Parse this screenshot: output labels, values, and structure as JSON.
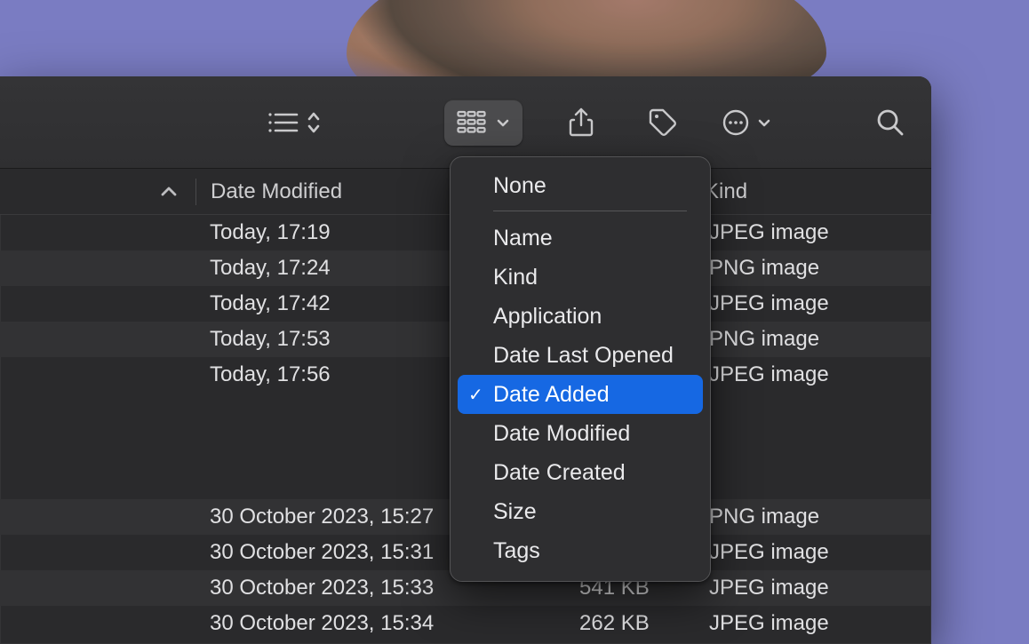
{
  "columns": {
    "date_modified": "Date Modified",
    "kind": "Kind"
  },
  "rows_top": [
    {
      "date": "Today, 17:19",
      "size": "",
      "kind": "JPEG image",
      "alt": false
    },
    {
      "date": "Today, 17:24",
      "size": "",
      "kind": "PNG image",
      "alt": true
    },
    {
      "date": "Today, 17:42",
      "size": "",
      "kind": "JPEG image",
      "alt": false
    },
    {
      "date": "Today, 17:53",
      "size": "",
      "kind": "PNG image",
      "alt": true
    },
    {
      "date": "Today, 17:56",
      "size": "",
      "kind": "JPEG image",
      "alt": false
    }
  ],
  "rows_bottom": [
    {
      "date": "30 October 2023, 15:27",
      "size": "",
      "kind": "PNG image",
      "alt": true
    },
    {
      "date": "30 October 2023, 15:31",
      "size": "",
      "kind": "JPEG image",
      "alt": false
    },
    {
      "date": "30 October 2023, 15:33",
      "size": "541 KB",
      "kind": "JPEG image",
      "alt": true
    },
    {
      "date": "30 October 2023, 15:34",
      "size": "262 KB",
      "kind": "JPEG image",
      "alt": false
    }
  ],
  "dropdown": {
    "selected": "date_added",
    "items": [
      {
        "key": "none",
        "label": "None",
        "separator_after": true
      },
      {
        "key": "name",
        "label": "Name"
      },
      {
        "key": "kind",
        "label": "Kind"
      },
      {
        "key": "application",
        "label": "Application"
      },
      {
        "key": "date_last_opened",
        "label": "Date Last Opened"
      },
      {
        "key": "date_added",
        "label": "Date Added"
      },
      {
        "key": "date_modified",
        "label": "Date Modified"
      },
      {
        "key": "date_created",
        "label": "Date Created"
      },
      {
        "key": "size",
        "label": "Size"
      },
      {
        "key": "tags",
        "label": "Tags"
      }
    ]
  }
}
